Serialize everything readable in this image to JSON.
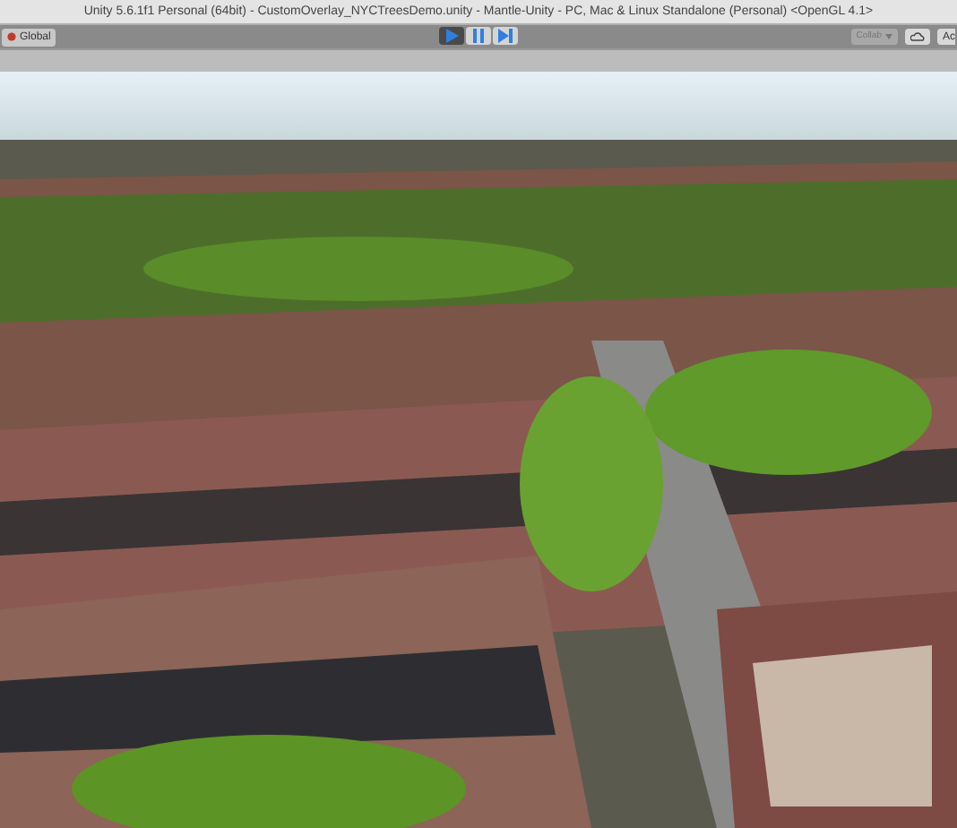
{
  "window": {
    "title": "Unity 5.6.1f1 Personal (64bit) - CustomOverlay_NYCTreesDemo.unity - Mantle-Unity - PC, Mac & Linux Standalone (Personal) <OpenGL 4.1>"
  },
  "toolbar": {
    "pivot_button": "Global",
    "playback": [
      {
        "kind": "play",
        "selected": true
      },
      {
        "kind": "pause",
        "selected": false
      },
      {
        "kind": "step",
        "selected": false
      }
    ],
    "collab_button": "Collab",
    "account_button": "Ac"
  }
}
